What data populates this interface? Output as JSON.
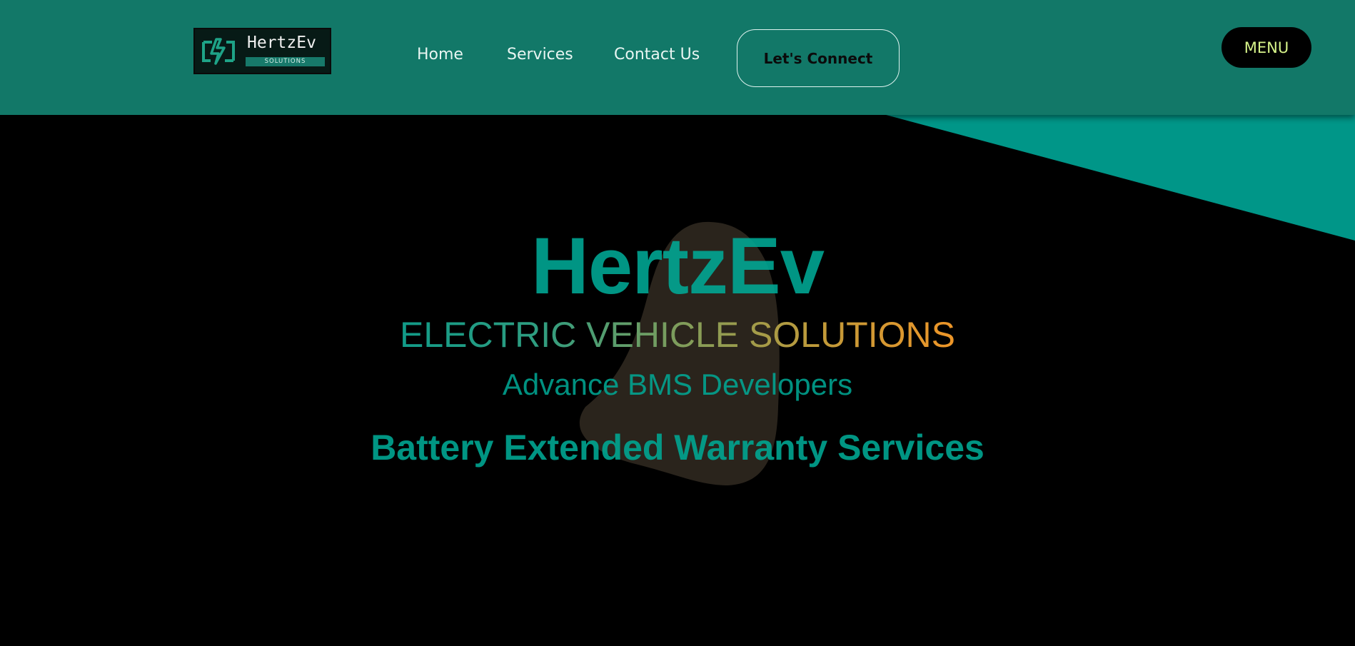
{
  "brand": {
    "logo_name": "HertzEv",
    "logo_subtitle": "SOLUTIONS"
  },
  "nav": {
    "items": [
      {
        "label": "Home"
      },
      {
        "label": "Services"
      },
      {
        "label": "Contact Us"
      }
    ],
    "cta_label": "Let's Connect",
    "menu_label": "MENU"
  },
  "hero": {
    "title": "HertzEv",
    "tagline": "ELECTRIC VEHICLE SOLUTIONS",
    "subtitle": "Advance BMS Developers",
    "service": "Battery Extended Warranty Services"
  },
  "colors": {
    "header_bg": "#127868",
    "accent": "#009688",
    "background": "#000000",
    "menu_text": "#d7f48a",
    "gradient_start": "#119b88",
    "gradient_end": "#ee9628"
  },
  "icons": {
    "logo_mark": "battery-bolt-icon"
  }
}
